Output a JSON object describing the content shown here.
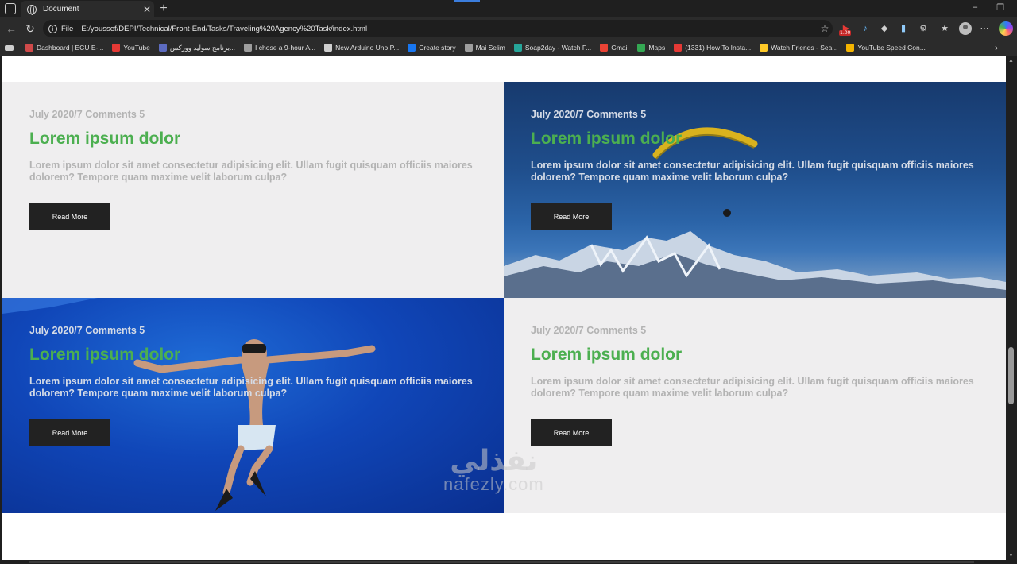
{
  "browser": {
    "tab_title": "Document",
    "url_scheme": "File",
    "url": "E:/youssef/DEPI/Technical/Front-End/Tasks/Traveling%20Agency%20Task/index.html",
    "ext_badge": "1.00",
    "bookmarks": [
      {
        "label": "Dashboard | ECU E-...",
        "icon_color": "#d04a4a"
      },
      {
        "label": "YouTube",
        "icon_color": "#e53935"
      },
      {
        "label": "برنامج سوليد ووركس...",
        "icon_color": "#5c6bc0"
      },
      {
        "label": "I chose a 9-hour A...",
        "icon_color": "#9e9e9e"
      },
      {
        "label": "New Arduino Uno P...",
        "icon_color": "#cfcfcf"
      },
      {
        "label": "Create story",
        "icon_color": "#1877f2"
      },
      {
        "label": "Mai Selim",
        "icon_color": "#9e9e9e"
      },
      {
        "label": "Soap2day - Watch F...",
        "icon_color": "#26a69a"
      },
      {
        "label": "Gmail",
        "icon_color": "#ea4335"
      },
      {
        "label": "Maps",
        "icon_color": "#34a853"
      },
      {
        "label": "(1331) How To Insta...",
        "icon_color": "#e53935"
      },
      {
        "label": "Watch Friends - Sea...",
        "icon_color": "#ffca28"
      },
      {
        "label": "YouTube Speed Con...",
        "icon_color": "#f4b400"
      }
    ]
  },
  "cards": [
    {
      "meta": "July 2020/7 Comments 5",
      "title": "Lorem ipsum dolor",
      "desc": "Lorem ipsum dolor sit amet consectetur adipisicing elit. Ullam fugit quisquam officiis maiores dolorem? Tempore quam maxime velit laborum culpa?",
      "button": "Read More",
      "background": "plain"
    },
    {
      "meta": "July 2020/7 Comments 5",
      "title": "Lorem ipsum dolor",
      "desc": "Lorem ipsum dolor sit amet consectetur adipisicing elit. Ullam fugit quisquam officiis maiores dolorem? Tempore quam maxime velit laborum culpa?",
      "button": "Read More",
      "background": "mountain-paraglider-photo"
    },
    {
      "meta": "July 2020/7 Comments 5",
      "title": "Lorem ipsum dolor",
      "desc": "Lorem ipsum dolor sit amet consectetur adipisicing elit. Ullam fugit quisquam officiis maiores dolorem? Tempore quam maxime velit laborum culpa?",
      "button": "Read More",
      "background": "underwater-diver-photo"
    },
    {
      "meta": "July 2020/7 Comments 5",
      "title": "Lorem ipsum dolor",
      "desc": "Lorem ipsum dolor sit amet consectetur adipisicing elit. Ullam fugit quisquam officiis maiores dolorem? Tempore quam maxime velit laborum culpa?",
      "button": "Read More",
      "background": "plain"
    }
  ],
  "watermark": {
    "arabic": "نفذلي",
    "latin": "nafezly.com"
  },
  "colors": {
    "accent_green": "#4caf50",
    "button_dark": "#222222",
    "card_light": "#efeeef"
  }
}
